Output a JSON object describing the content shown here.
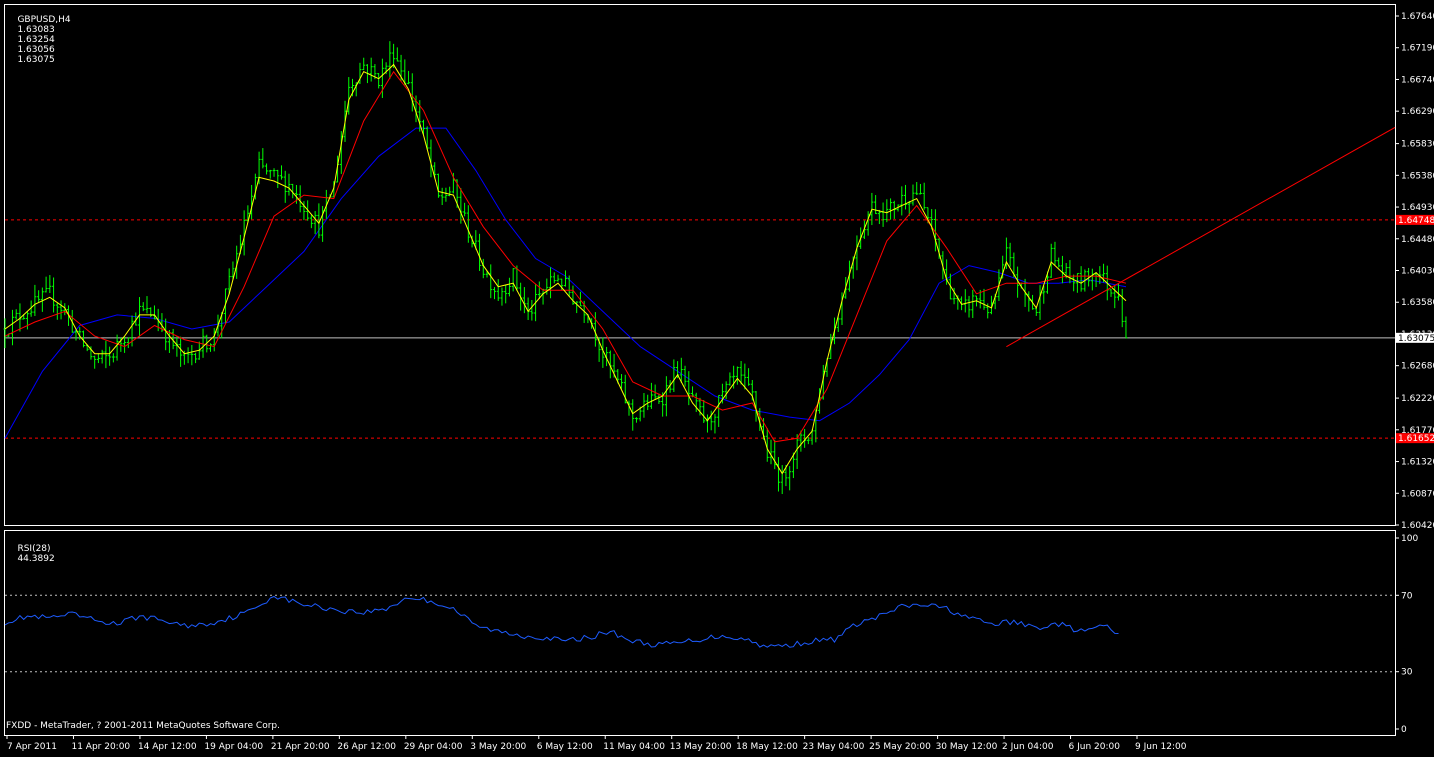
{
  "main_header": {
    "symbol": "GBPUSD,H4",
    "open": "1.63083",
    "high": "1.63254",
    "low": "1.63056",
    "close": "1.63075"
  },
  "rsi_header": {
    "name": "RSI(28)",
    "value": "44.3892"
  },
  "copyright": "FXDD - MetaTrader, ? 2001-2011 MetaQuotes Software Corp.",
  "colors": {
    "background": "#000000",
    "frame": "#ffffff",
    "candles": "#00ff00",
    "ma_fast": "#ffff00",
    "ma_mid": "#ff0000",
    "ma_slow": "#0000ff",
    "rsi_line": "#1e5cff",
    "level_line": "#ff0000",
    "price_line": "#c0c0c0",
    "level_label_bg": "#ff0000",
    "price_label_bg": "#ffffff"
  },
  "chart_data": [
    {
      "type": "candlestick",
      "ylim": [
        1.6042,
        1.6764
      ],
      "y_ticks": [
        "1.67640",
        "1.67190",
        "1.66740",
        "1.66290",
        "1.65830",
        "1.65380",
        "1.64930",
        "1.64480",
        "1.64030",
        "1.63580",
        "1.63130",
        "1.62680",
        "1.62220",
        "1.61770",
        "1.61320",
        "1.60870",
        "1.60420"
      ],
      "x_ticks": [
        "7 Apr 2011",
        "11 Apr 20:00",
        "14 Apr 12:00",
        "19 Apr 04:00",
        "21 Apr 20:00",
        "26 Apr 12:00",
        "29 Apr 04:00",
        "3 May 20:00",
        "6 May 12:00",
        "11 May 04:00",
        "13 May 20:00",
        "18 May 12:00",
        "23 May 04:00",
        "25 May 20:00",
        "30 May 12:00",
        "2 Jun 04:00",
        "6 Jun 20:00",
        "9 Jun 12:00"
      ],
      "close_path": [
        [
          0,
          1.632
        ],
        [
          4,
          1.634
        ],
        [
          8,
          1.6355
        ],
        [
          12,
          1.637
        ],
        [
          16,
          1.6345
        ],
        [
          20,
          1.6305
        ],
        [
          24,
          1.6275
        ],
        [
          28,
          1.628
        ],
        [
          32,
          1.631
        ],
        [
          36,
          1.6345
        ],
        [
          40,
          1.634
        ],
        [
          44,
          1.6305
        ],
        [
          48,
          1.6275
        ],
        [
          52,
          1.6295
        ],
        [
          56,
          1.631
        ],
        [
          60,
          1.6385
        ],
        [
          64,
          1.6465
        ],
        [
          68,
          1.655
        ],
        [
          72,
          1.6535
        ],
        [
          76,
          1.6525
        ],
        [
          80,
          1.6495
        ],
        [
          84,
          1.6465
        ],
        [
          88,
          1.6525
        ],
        [
          92,
          1.6665
        ],
        [
          96,
          1.6695
        ],
        [
          100,
          1.6675
        ],
        [
          104,
          1.6715
        ],
        [
          108,
          1.6665
        ],
        [
          112,
          1.6595
        ],
        [
          116,
          1.6505
        ],
        [
          120,
          1.652
        ],
        [
          124,
          1.646
        ],
        [
          128,
          1.6405
        ],
        [
          132,
          1.637
        ],
        [
          136,
          1.6395
        ],
        [
          140,
          1.634
        ],
        [
          144,
          1.6375
        ],
        [
          148,
          1.6395
        ],
        [
          152,
          1.6365
        ],
        [
          156,
          1.6345
        ],
        [
          160,
          1.6285
        ],
        [
          164,
          1.6245
        ],
        [
          168,
          1.6195
        ],
        [
          172,
          1.6215
        ],
        [
          176,
          1.6225
        ],
        [
          180,
          1.6265
        ],
        [
          184,
          1.6215
        ],
        [
          188,
          1.6185
        ],
        [
          192,
          1.6225
        ],
        [
          196,
          1.6255
        ],
        [
          200,
          1.6225
        ],
        [
          204,
          1.6145
        ],
        [
          208,
          1.6105
        ],
        [
          212,
          1.6155
        ],
        [
          216,
          1.6175
        ],
        [
          220,
          1.6285
        ],
        [
          224,
          1.6365
        ],
        [
          228,
          1.6445
        ],
        [
          232,
          1.6495
        ],
        [
          236,
          1.6485
        ],
        [
          240,
          1.6505
        ],
        [
          244,
          1.6515
        ],
        [
          248,
          1.6465
        ],
        [
          252,
          1.6385
        ],
        [
          256,
          1.6345
        ],
        [
          260,
          1.6365
        ],
        [
          264,
          1.6345
        ],
        [
          268,
          1.6425
        ],
        [
          272,
          1.6375
        ],
        [
          276,
          1.6345
        ],
        [
          280,
          1.6425
        ],
        [
          284,
          1.6395
        ],
        [
          288,
          1.6385
        ],
        [
          292,
          1.6405
        ],
        [
          296,
          1.6375
        ],
        [
          298,
          1.6375
        ],
        [
          300,
          1.63075
        ]
      ],
      "ma_fast": [
        [
          0,
          1.632
        ],
        [
          4,
          1.6335
        ],
        [
          8,
          1.6355
        ],
        [
          12,
          1.6365
        ],
        [
          16,
          1.635
        ],
        [
          20,
          1.631
        ],
        [
          24,
          1.6285
        ],
        [
          28,
          1.6285
        ],
        [
          32,
          1.631
        ],
        [
          36,
          1.634
        ],
        [
          40,
          1.634
        ],
        [
          44,
          1.631
        ],
        [
          48,
          1.6285
        ],
        [
          52,
          1.629
        ],
        [
          56,
          1.631
        ],
        [
          60,
          1.637
        ],
        [
          64,
          1.645
        ],
        [
          68,
          1.6535
        ],
        [
          72,
          1.653
        ],
        [
          76,
          1.652
        ],
        [
          80,
          1.6495
        ],
        [
          84,
          1.647
        ],
        [
          88,
          1.652
        ],
        [
          92,
          1.6645
        ],
        [
          96,
          1.6685
        ],
        [
          100,
          1.6675
        ],
        [
          104,
          1.6695
        ],
        [
          108,
          1.666
        ],
        [
          112,
          1.6595
        ],
        [
          116,
          1.6515
        ],
        [
          120,
          1.651
        ],
        [
          124,
          1.646
        ],
        [
          128,
          1.641
        ],
        [
          132,
          1.638
        ],
        [
          136,
          1.6385
        ],
        [
          140,
          1.6345
        ],
        [
          144,
          1.637
        ],
        [
          148,
          1.6385
        ],
        [
          152,
          1.636
        ],
        [
          156,
          1.634
        ],
        [
          160,
          1.629
        ],
        [
          164,
          1.6245
        ],
        [
          168,
          1.62
        ],
        [
          172,
          1.6215
        ],
        [
          176,
          1.6225
        ],
        [
          180,
          1.6255
        ],
        [
          184,
          1.6215
        ],
        [
          188,
          1.619
        ],
        [
          192,
          1.622
        ],
        [
          196,
          1.625
        ],
        [
          200,
          1.6225
        ],
        [
          204,
          1.615
        ],
        [
          208,
          1.6115
        ],
        [
          212,
          1.615
        ],
        [
          216,
          1.6175
        ],
        [
          220,
          1.6275
        ],
        [
          224,
          1.636
        ],
        [
          228,
          1.6435
        ],
        [
          232,
          1.649
        ],
        [
          236,
          1.6485
        ],
        [
          240,
          1.6495
        ],
        [
          244,
          1.6505
        ],
        [
          248,
          1.6465
        ],
        [
          252,
          1.639
        ],
        [
          256,
          1.6355
        ],
        [
          260,
          1.636
        ],
        [
          264,
          1.635
        ],
        [
          268,
          1.6415
        ],
        [
          272,
          1.638
        ],
        [
          276,
          1.635
        ],
        [
          280,
          1.6415
        ],
        [
          284,
          1.6395
        ],
        [
          288,
          1.6385
        ],
        [
          292,
          1.64
        ],
        [
          296,
          1.638
        ],
        [
          300,
          1.636
        ]
      ],
      "ma_mid": [
        [
          0,
          1.631
        ],
        [
          8,
          1.633
        ],
        [
          16,
          1.6345
        ],
        [
          24,
          1.631
        ],
        [
          32,
          1.6295
        ],
        [
          40,
          1.6325
        ],
        [
          48,
          1.6305
        ],
        [
          56,
          1.6295
        ],
        [
          64,
          1.638
        ],
        [
          72,
          1.648
        ],
        [
          80,
          1.651
        ],
        [
          88,
          1.6505
        ],
        [
          96,
          1.6615
        ],
        [
          104,
          1.6685
        ],
        [
          112,
          1.663
        ],
        [
          120,
          1.6535
        ],
        [
          128,
          1.6465
        ],
        [
          136,
          1.641
        ],
        [
          144,
          1.6375
        ],
        [
          152,
          1.6375
        ],
        [
          160,
          1.632
        ],
        [
          168,
          1.6245
        ],
        [
          176,
          1.6225
        ],
        [
          184,
          1.6225
        ],
        [
          192,
          1.6205
        ],
        [
          200,
          1.6215
        ],
        [
          206,
          1.616
        ],
        [
          212,
          1.6165
        ],
        [
          220,
          1.6235
        ],
        [
          228,
          1.634
        ],
        [
          236,
          1.6445
        ],
        [
          244,
          1.6495
        ],
        [
          252,
          1.6435
        ],
        [
          260,
          1.637
        ],
        [
          268,
          1.6385
        ],
        [
          276,
          1.6385
        ],
        [
          284,
          1.6395
        ],
        [
          292,
          1.6395
        ],
        [
          300,
          1.6385
        ]
      ],
      "ma_slow": [
        [
          0,
          1.6165
        ],
        [
          10,
          1.626
        ],
        [
          20,
          1.6325
        ],
        [
          30,
          1.634
        ],
        [
          40,
          1.6335
        ],
        [
          50,
          1.632
        ],
        [
          60,
          1.633
        ],
        [
          70,
          1.638
        ],
        [
          80,
          1.643
        ],
        [
          90,
          1.6505
        ],
        [
          100,
          1.6565
        ],
        [
          110,
          1.6605
        ],
        [
          118,
          1.6605
        ],
        [
          126,
          1.6545
        ],
        [
          134,
          1.6475
        ],
        [
          142,
          1.642
        ],
        [
          150,
          1.6395
        ],
        [
          160,
          1.6345
        ],
        [
          170,
          1.6295
        ],
        [
          180,
          1.626
        ],
        [
          190,
          1.6225
        ],
        [
          200,
          1.6205
        ],
        [
          210,
          1.6195
        ],
        [
          218,
          1.619
        ],
        [
          226,
          1.6215
        ],
        [
          234,
          1.6255
        ],
        [
          242,
          1.6305
        ],
        [
          250,
          1.6385
        ],
        [
          258,
          1.641
        ],
        [
          266,
          1.64
        ],
        [
          274,
          1.6385
        ],
        [
          282,
          1.6385
        ],
        [
          290,
          1.639
        ],
        [
          300,
          1.638
        ]
      ],
      "levels": [
        {
          "price": 1.64748,
          "label": "1.64748"
        },
        {
          "price": 1.61652,
          "label": "1.61652"
        }
      ],
      "current_price": {
        "price": 1.63075,
        "label": "1.63075"
      },
      "trendline": {
        "from": [
          268,
          1.6295
        ],
        "to": [
          372,
          1.6606
        ]
      }
    },
    {
      "type": "line",
      "name": "RSI(28)",
      "ylim": [
        0,
        100
      ],
      "y_ticks": [
        "100",
        "70",
        "30",
        "0"
      ],
      "levels": [
        70,
        30
      ],
      "x": [
        0,
        6,
        12,
        18,
        24,
        30,
        36,
        42,
        48,
        54,
        60,
        66,
        72,
        78,
        84,
        90,
        96,
        102,
        108,
        114,
        120,
        126,
        132,
        138,
        144,
        150,
        156,
        162,
        168,
        174,
        180,
        186,
        192,
        198,
        204,
        210,
        216,
        222,
        228,
        234,
        240,
        246,
        252,
        258,
        264,
        270,
        276,
        282,
        288,
        294,
        298
      ],
      "values": [
        56,
        59,
        58,
        60,
        57,
        55,
        59,
        57,
        54,
        55,
        58,
        62,
        70,
        66,
        64,
        62,
        61,
        63,
        69,
        67,
        63,
        54,
        51,
        49,
        48,
        46,
        48,
        51,
        46,
        44,
        45,
        47,
        49,
        47,
        43,
        44,
        46,
        47,
        55,
        59,
        64,
        65,
        63,
        58,
        55,
        56,
        53,
        55,
        51,
        54,
        50
      ]
    }
  ]
}
